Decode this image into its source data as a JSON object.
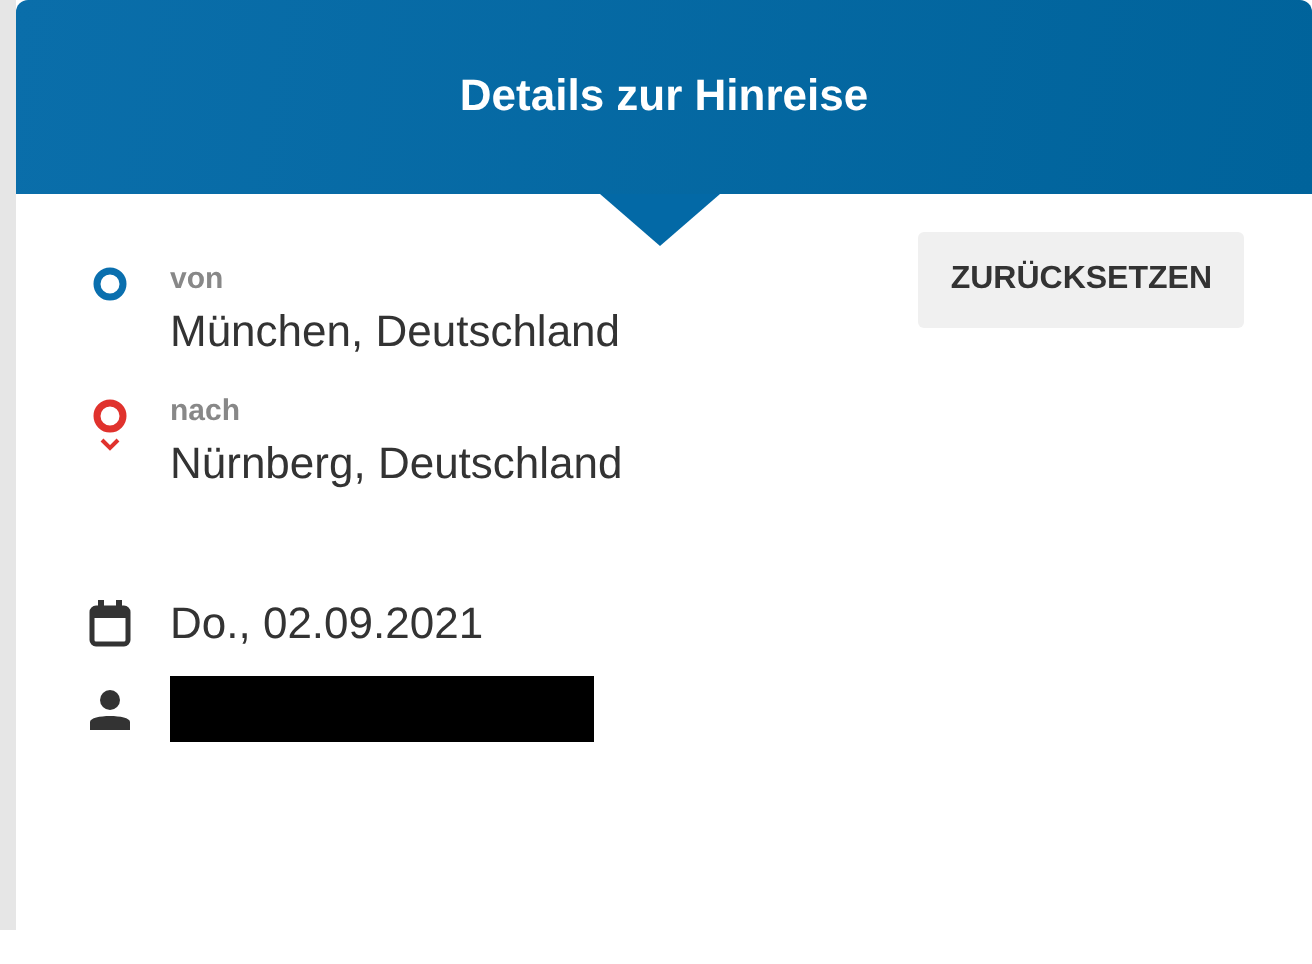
{
  "header": {
    "title": "Details zur Hinreise"
  },
  "reset_button": "ZURÜCKSETZEN",
  "stops": [
    {
      "kind": "origin",
      "label": "von",
      "place": "München, Deutschland"
    },
    {
      "kind": "destination",
      "label": "nach",
      "place": "Nürnberg, Deutschland"
    }
  ],
  "date": "Do., 02.09.2021",
  "traveler": {
    "redacted": true
  }
}
